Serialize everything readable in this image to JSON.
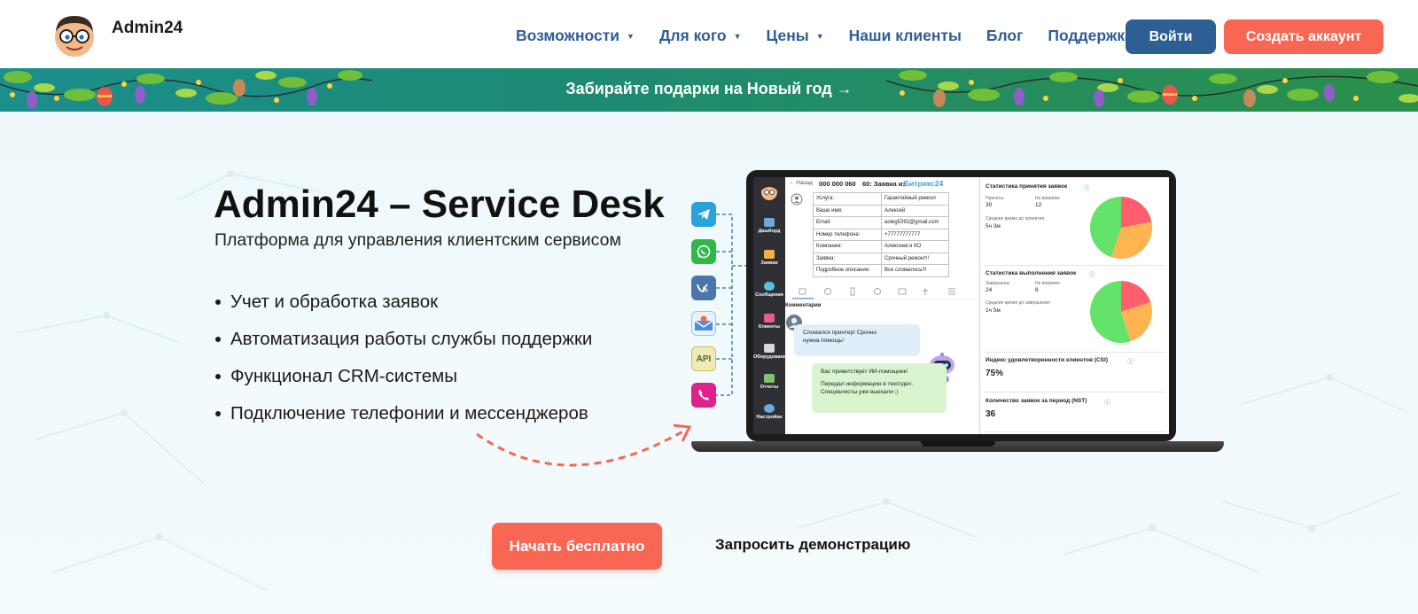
{
  "header": {
    "logo_text": "Admin24",
    "nav": [
      {
        "label": "Возможности",
        "has_dropdown": true
      },
      {
        "label": "Для кого",
        "has_dropdown": true
      },
      {
        "label": "Цены",
        "has_dropdown": true
      },
      {
        "label": "Наши клиенты",
        "has_dropdown": false
      },
      {
        "label": "Блог",
        "has_dropdown": false
      },
      {
        "label": "Поддержка",
        "has_dropdown": false
      }
    ],
    "login_label": "Войти",
    "signup_label": "Создать аккаунт"
  },
  "banner": {
    "text": "Забирайте подарки на Новый год →"
  },
  "hero": {
    "title": "Admin24 – Service Desk",
    "subtitle": "Платформа для управления клиентским сервисом",
    "features": [
      "Учет и обработка заявок",
      "Автоматизация работы службы поддержки",
      "Функционал CRM-системы",
      "Подключение телефонии и мессенджеров"
    ],
    "start_label": "Начать бесплатно",
    "demo_label": "Запросить демонстрацию"
  },
  "channels": [
    "telegram-icon",
    "whatsapp-icon",
    "vk-icon",
    "email-icon",
    "api-icon",
    "viber-icon"
  ],
  "app_preview": {
    "api_badge": "API",
    "back_label": "← Назад",
    "ticket_number": "000 000 060",
    "ticket_title": "60: Заявка из",
    "ticket_source": "Битрикс24",
    "sidebar": [
      "Дашборд",
      "Заявки",
      "Сообщения",
      "Клиенты",
      "Оборудование",
      "Отчеты",
      "Настройки"
    ],
    "form": [
      {
        "key": "Услуга:",
        "value": "Гарантийный ремонт"
      },
      {
        "key": "Ваше имя:",
        "value": "Алексей"
      },
      {
        "key": "Email:",
        "value": "aoleg5392@gmail.com"
      },
      {
        "key": "Номер телефона:",
        "value": "+77777777777"
      },
      {
        "key": "Компания:",
        "value": "Алексеев и КО"
      },
      {
        "key": "Заявка:",
        "value": "Срочный ремонт!!"
      },
      {
        "key": "Подробное описание:",
        "value": "Все сломалось!!!"
      }
    ],
    "comments_label": "Комментарии",
    "client_message_line1": "Сломался принтер! Срочно",
    "client_message_line2": "нужна помощь!",
    "bot_message_line1": "Вас приветствует ИИ-помощник!",
    "bot_message_line2": "Передал информацию в техотдел.",
    "bot_message_line3": "Специалисты уже выехали ;)",
    "stats": {
      "accept_title": "Статистика принятия заявок",
      "accepted_label": "Приняты",
      "accepted_value": "30",
      "not_in_time_label": "Не вовремя",
      "not_in_time_value": "12",
      "avg_accept_label": "Среднее время до принятия",
      "avg_accept_value": "5ч 3м",
      "done_title": "Статистика выполнения заявок",
      "done_label": "Завершены",
      "done_value": "24",
      "done_late_label": "Не вовремя",
      "done_late_value": "8",
      "avg_done_label": "Среднее время до завершения",
      "avg_done_value": "1ч 5м",
      "csi_title": "Индекс удовлетворенности клиентов (CSI)",
      "csi_value": "75%",
      "nst_title": "Количество заявок за период (NST)",
      "nst_value": "36"
    },
    "pie_accept": [
      0.45,
      0.22,
      0.33
    ],
    "pie_done": [
      0.55,
      0.25,
      0.2
    ],
    "pie_colors": [
      "#65e26a",
      "#ff5f6d",
      "#ffb452"
    ]
  },
  "colors": {
    "brand_blue": "#2d5f94",
    "accent_coral": "#f96654"
  }
}
